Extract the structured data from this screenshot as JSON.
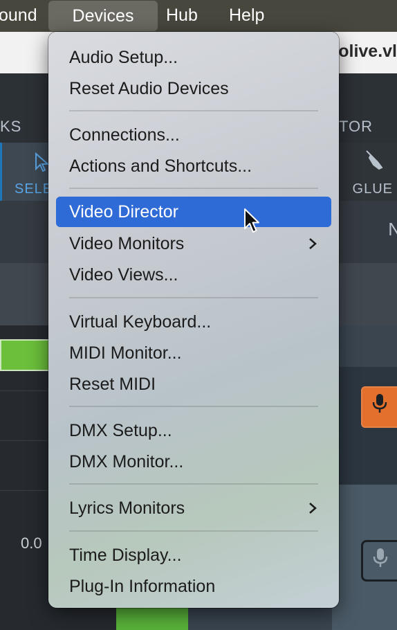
{
  "menubar": {
    "items": [
      "ound",
      "Devices",
      "Hub",
      "Help"
    ],
    "active_index": 1
  },
  "background": {
    "window_title": "olive.vl",
    "toolbar_left_label": "KS",
    "toolbar_right_label": "TOR",
    "select_tool_label": "SELE",
    "glue_tool_label": "GLUE",
    "side_letter": "N",
    "cell_value": "0.0"
  },
  "devices_menu": {
    "sections": [
      [
        {
          "label": "Audio Setup..."
        },
        {
          "label": "Reset Audio Devices"
        }
      ],
      [
        {
          "label": "Connections..."
        },
        {
          "label": "Actions and Shortcuts..."
        }
      ],
      [
        {
          "label": "Video Director",
          "highlighted": true
        },
        {
          "label": "Video Monitors",
          "submenu": true
        },
        {
          "label": "Video Views..."
        }
      ],
      [
        {
          "label": "Virtual Keyboard..."
        },
        {
          "label": "MIDI Monitor..."
        },
        {
          "label": "Reset MIDI"
        }
      ],
      [
        {
          "label": "DMX Setup..."
        },
        {
          "label": "DMX Monitor..."
        }
      ],
      [
        {
          "label": "Lyrics Monitors",
          "submenu": true
        }
      ],
      [
        {
          "label": "Time Display..."
        },
        {
          "label": "Plug-In Information"
        }
      ]
    ]
  },
  "colors": {
    "menu_highlight": "#2f6bd7",
    "record_arm": "#e4702d",
    "meter_green": "#6bbf3b"
  },
  "icons": [
    "arrow-cursor-icon",
    "chevron-right-icon",
    "microphone-icon",
    "glue-icon",
    "select-arrow-icon"
  ]
}
